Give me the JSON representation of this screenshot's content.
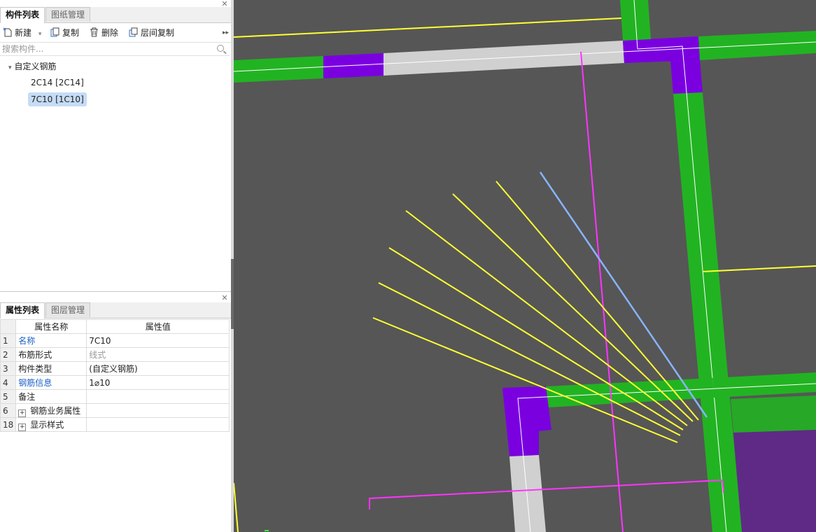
{
  "components_panel": {
    "tabs": [
      "构件列表",
      "图纸管理"
    ],
    "toolbar": {
      "new_label": "新建",
      "copy_label": "复制",
      "delete_label": "删除",
      "floor_copy_label": "层间复制"
    },
    "search": {
      "placeholder": "搜索构件..."
    },
    "tree": {
      "root_label": "自定义钢筋",
      "items": [
        "2C14 [2C14]",
        "7C10 [1C10]"
      ],
      "selected_index": 1
    }
  },
  "properties_panel": {
    "tabs": [
      "属性列表",
      "图层管理"
    ],
    "headers": {
      "name": "属性名称",
      "value": "属性值"
    },
    "rows": [
      {
        "num": "1",
        "name": "名称",
        "value": "7C10"
      },
      {
        "num": "2",
        "name": "布筋形式",
        "value": "线式"
      },
      {
        "num": "3",
        "name": "构件类型",
        "value": "(自定义钢筋)"
      },
      {
        "num": "4",
        "name": "钢筋信息",
        "value": "1⌀10"
      },
      {
        "num": "5",
        "name": "备注",
        "value": ""
      },
      {
        "num": "6",
        "name": "钢筋业务属性",
        "value": ""
      },
      {
        "num": "18",
        "name": "显示样式",
        "value": ""
      }
    ]
  },
  "canvas": {
    "background": "#565656",
    "colors": {
      "wall_green": "#22b322",
      "wall_purple": "#7a00e0",
      "wall_grey": "#d0d0d0",
      "rebar_yellow": "#ffff33",
      "rebar_blue": "#88b4ff",
      "line_magenta": "#ff33ff",
      "fill_purple": "#5e2a86"
    }
  }
}
